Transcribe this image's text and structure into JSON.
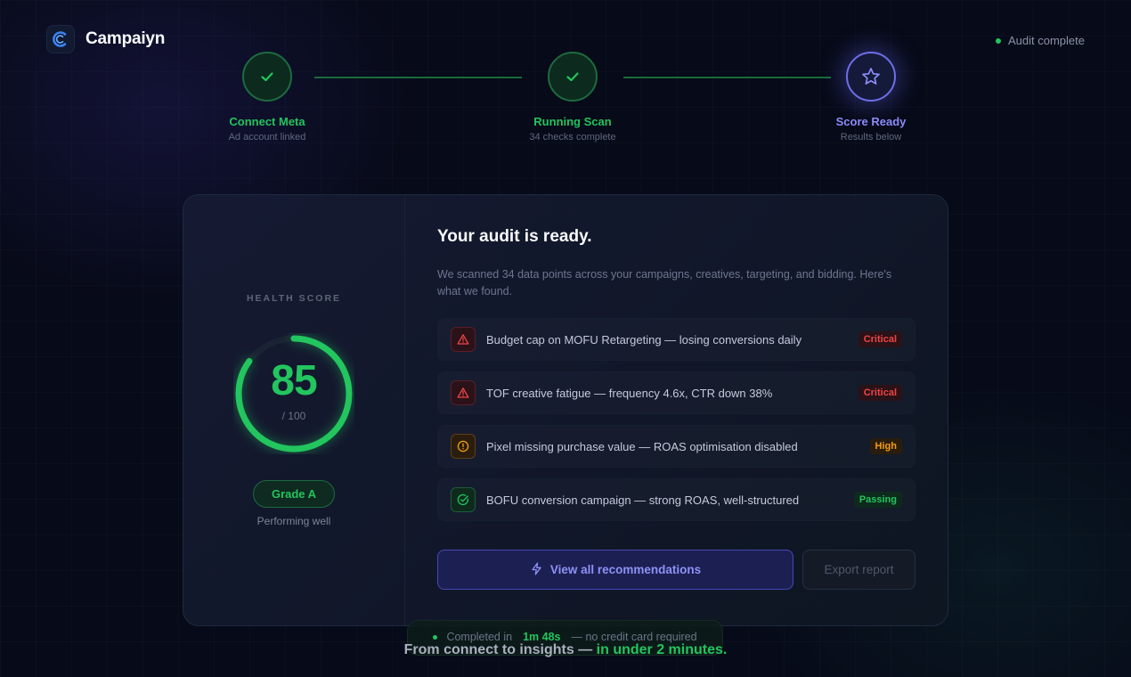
{
  "brand": {
    "name": "Campaiyn"
  },
  "status": {
    "label": "Audit complete"
  },
  "steps": [
    {
      "title": "Connect Meta",
      "subtitle": "Ad account linked"
    },
    {
      "title": "Running Scan",
      "subtitle": "34 checks complete"
    },
    {
      "title": "Score Ready",
      "subtitle": "Results below"
    }
  ],
  "score": {
    "label": "HEALTH SCORE",
    "value": "85",
    "max_label": "/ 100",
    "fraction": 0.85,
    "grade": "Grade A",
    "grade_sub": "Performing well"
  },
  "audit": {
    "title": "Your audit is ready.",
    "description": "We scanned 34 data points across your campaigns, creatives, targeting, and bidding. Here's what we found.",
    "findings": [
      {
        "text": "Budget cap on MOFU Retargeting — losing conversions daily",
        "badge": "Critical",
        "icon": "warning-triangle-icon"
      },
      {
        "text": "TOF creative fatigue — frequency 4.6x, CTR down 38%",
        "badge": "Critical",
        "icon": "warning-triangle-icon"
      },
      {
        "text": "Pixel missing purchase value — ROAS optimisation disabled",
        "badge": "High",
        "icon": "alert-circle-icon"
      },
      {
        "text": "BOFU conversion campaign — strong ROAS, well-structured",
        "badge": "Passing",
        "icon": "check-circle-icon"
      }
    ],
    "primary_button": "View all recommendations",
    "secondary_button": "Export report"
  },
  "footer": {
    "completed_prefix": "Completed in",
    "completed_time": "1m 48s",
    "completed_suffix": "— no credit card required",
    "tagline_main": "From connect to insights —",
    "tagline_highlight": "in under 2 minutes."
  },
  "colors": {
    "background": "#070a18",
    "success": "#22c55e",
    "accent": "#8b8cf8",
    "critical": "#ef4444",
    "high": "#f59e0b"
  }
}
